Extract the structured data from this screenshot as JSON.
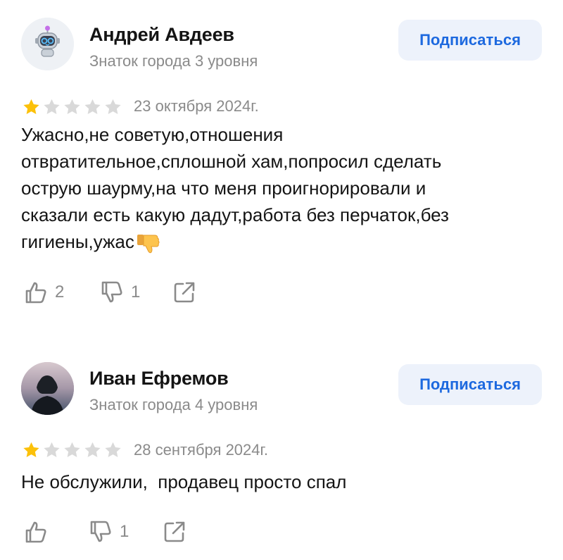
{
  "reviews": [
    {
      "author": "Андрей Авдеев",
      "level": "Знаток города 3 уровня",
      "subscribe_label": "Подписаться",
      "avatar_icon": "robot-avatar-icon",
      "rating": 1,
      "max_rating": 5,
      "date": "23 октября 2024г.",
      "text": "Ужасно,не советую,отношения\nотвратительное,сплошной хам,попросил сделать\nострую шаурму,на что меня проигнорировали и\nсказали есть какую дадут,работа без перчаток,без\nгигиены,ужас",
      "likes": "2",
      "dislikes": "1"
    },
    {
      "author": "Иван Ефремов",
      "level": "Знаток города 4 уровня",
      "subscribe_label": "Подписаться",
      "avatar_icon": "user-photo-avatar",
      "rating": 1,
      "max_rating": 5,
      "date": "28 сентября 2024г.",
      "text": "Не обслужили,  продавец просто спал",
      "likes": "",
      "dislikes": "1"
    }
  ],
  "colors": {
    "accent": "#1d69df",
    "button_bg": "#edf2fb",
    "star_filled": "#fcc10a",
    "star_empty": "#d9d9d9",
    "muted_text": "#8a8a8a"
  }
}
